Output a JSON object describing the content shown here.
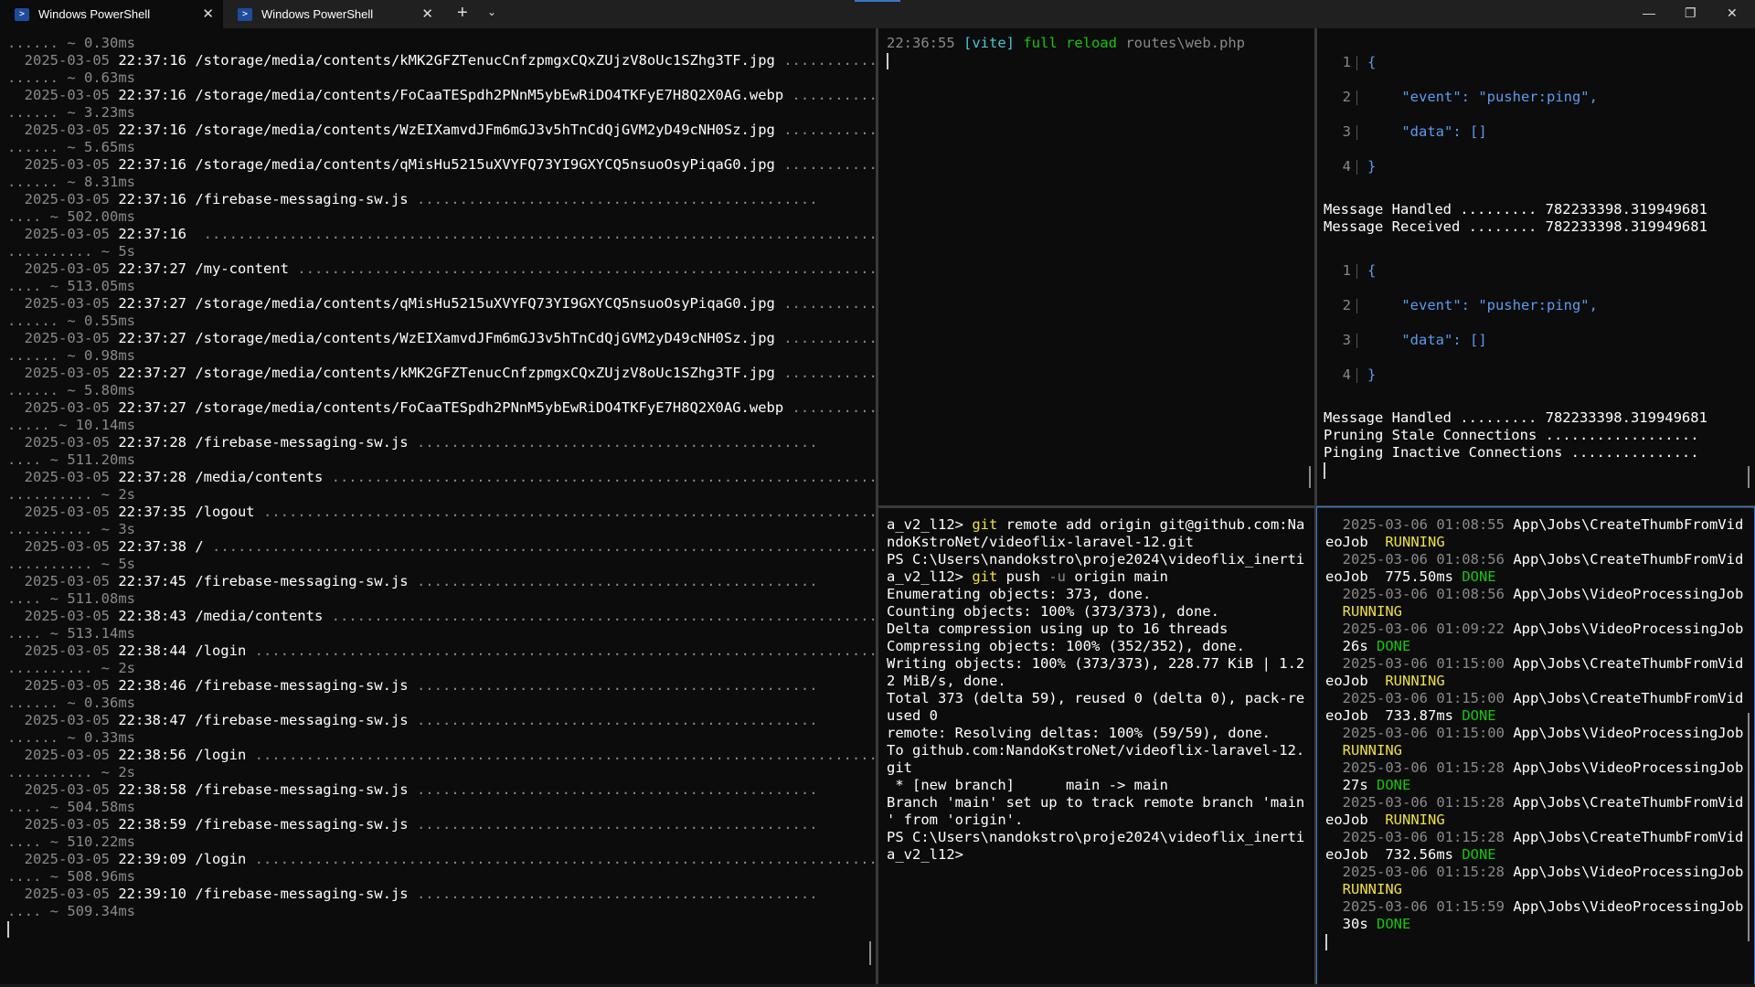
{
  "tabs": [
    {
      "label": "Windows PowerShell",
      "active": true
    },
    {
      "label": "Windows PowerShell",
      "active": false
    }
  ],
  "icons": {
    "tab_icon": "powershell-icon",
    "close": "close-icon",
    "new_tab": "plus-icon",
    "dropdown": "chevron-down-icon",
    "minimize": "minimize-icon",
    "restore": "restore-icon",
    "window_close": "close-icon"
  },
  "left_pane": {
    "lines": [
      {
        "d": "...... ~ 0.30ms"
      },
      {
        "date": "2025-03-05",
        "time": "22:37:16",
        "path": "/storage/media/contents/kMK2GFZTenucCnfzpmgxCQxZUjzV8oUc1SZhg3TF.jpg",
        "dots": " ..........."
      },
      {
        "d": "...... ~ 0.63ms"
      },
      {
        "date": "2025-03-05",
        "time": "22:37:16",
        "path": "/storage/media/contents/FoCaaTESpdh2PNnM5ybEwRiDO4TKFyE7H8Q2X0AG.webp",
        "dots": " .........."
      },
      {
        "d": "...... ~ 3.23ms"
      },
      {
        "date": "2025-03-05",
        "time": "22:37:16",
        "path": "/storage/media/contents/WzEIXamvdJFm6mGJ3v5hTnCdQjGVM2yD49cNH0Sz.jpg",
        "dots": " ..........."
      },
      {
        "d": "...... ~ 5.65ms"
      },
      {
        "date": "2025-03-05",
        "time": "22:37:16",
        "path": "/storage/media/contents/qMisHu5215uXVYFQ73YI9GXYCQ5nsuoOsyPiqaG0.jpg",
        "dots": " ..........."
      },
      {
        "d": "...... ~ 8.31ms"
      },
      {
        "date": "2025-03-05",
        "time": "22:37:16",
        "path": "/firebase-messaging-sw.js",
        "dots": " ..............................................."
      },
      {
        "d": ".... ~ 502.00ms"
      },
      {
        "date": "2025-03-05",
        "time": "22:37:16",
        "path": "",
        "dots": " ................................................................................"
      },
      {
        "d": ".......... ~ 5s"
      },
      {
        "date": "2025-03-05",
        "time": "22:37:27",
        "path": "/my-content",
        "dots": " ........................................................................"
      },
      {
        "d": ".... ~ 513.05ms"
      },
      {
        "date": "2025-03-05",
        "time": "22:37:27",
        "path": "/storage/media/contents/qMisHu5215uXVYFQ73YI9GXYCQ5nsuoOsyPiqaG0.jpg",
        "dots": " ..........."
      },
      {
        "d": "...... ~ 0.55ms"
      },
      {
        "date": "2025-03-05",
        "time": "22:37:27",
        "path": "/storage/media/contents/WzEIXamvdJFm6mGJ3v5hTnCdQjGVM2yD49cNH0Sz.jpg",
        "dots": " ..........."
      },
      {
        "d": "...... ~ 0.98ms"
      },
      {
        "date": "2025-03-05",
        "time": "22:37:27",
        "path": "/storage/media/contents/kMK2GFZTenucCnfzpmgxCQxZUjzV8oUc1SZhg3TF.jpg",
        "dots": " ..........."
      },
      {
        "d": "...... ~ 5.80ms"
      },
      {
        "date": "2025-03-05",
        "time": "22:37:27",
        "path": "/storage/media/contents/FoCaaTESpdh2PNnM5ybEwRiDO4TKFyE7H8Q2X0AG.webp",
        "dots": " .........."
      },
      {
        "d": "..... ~ 10.14ms"
      },
      {
        "date": "2025-03-05",
        "time": "22:37:28",
        "path": "/firebase-messaging-sw.js",
        "dots": " ..............................................."
      },
      {
        "d": ".... ~ 511.20ms"
      },
      {
        "date": "2025-03-05",
        "time": "22:37:28",
        "path": "/media/contents",
        "dots": " ..................................................................."
      },
      {
        "d": ".......... ~ 2s"
      },
      {
        "date": "2025-03-05",
        "time": "22:37:35",
        "path": "/logout",
        "dots": " ..........................................................................."
      },
      {
        "d": ".......... ~ 3s"
      },
      {
        "date": "2025-03-05",
        "time": "22:37:38",
        "path": "/",
        "dots": " ................................................................................."
      },
      {
        "d": ".......... ~ 5s"
      },
      {
        "date": "2025-03-05",
        "time": "22:37:45",
        "path": "/firebase-messaging-sw.js",
        "dots": " ..............................................."
      },
      {
        "d": ".... ~ 511.08ms"
      },
      {
        "date": "2025-03-05",
        "time": "22:38:43",
        "path": "/media/contents",
        "dots": " ..................................................................."
      },
      {
        "d": ".... ~ 513.14ms"
      },
      {
        "date": "2025-03-05",
        "time": "22:38:44",
        "path": "/login",
        "dots": " ..........................................................................."
      },
      {
        "d": ".......... ~ 2s"
      },
      {
        "date": "2025-03-05",
        "time": "22:38:46",
        "path": "/firebase-messaging-sw.js",
        "dots": " ..............................................."
      },
      {
        "d": "...... ~ 0.36ms"
      },
      {
        "date": "2025-03-05",
        "time": "22:38:47",
        "path": "/firebase-messaging-sw.js",
        "dots": " ..............................................."
      },
      {
        "d": "...... ~ 0.33ms"
      },
      {
        "date": "2025-03-05",
        "time": "22:38:56",
        "path": "/login",
        "dots": " ..........................................................................."
      },
      {
        "d": ".......... ~ 2s"
      },
      {
        "date": "2025-03-05",
        "time": "22:38:58",
        "path": "/firebase-messaging-sw.js",
        "dots": " ..............................................."
      },
      {
        "d": ".... ~ 504.58ms"
      },
      {
        "date": "2025-03-05",
        "time": "22:38:59",
        "path": "/firebase-messaging-sw.js",
        "dots": " ..............................................."
      },
      {
        "d": ".... ~ 510.22ms"
      },
      {
        "date": "2025-03-05",
        "time": "22:39:09",
        "path": "/login",
        "dots": " ..........................................................................."
      },
      {
        "d": ".... ~ 508.96ms"
      },
      {
        "date": "2025-03-05",
        "time": "22:39:10",
        "path": "/firebase-messaging-sw.js",
        "dots": " ..............................................."
      },
      {
        "d": ".... ~ 509.34ms"
      }
    ]
  },
  "vite_pane": {
    "time": "22:36:55",
    "tag": "[vite]",
    "action": "full reload",
    "file": "routes\\web.php"
  },
  "json_pane": {
    "blocks": [
      {
        "lines": [
          {
            "n": "1",
            "code": "{"
          },
          {
            "n": "2",
            "code": "    \"event\": \"pusher:ping\","
          },
          {
            "n": "3",
            "code": "    \"data\": []"
          },
          {
            "n": "4",
            "code": "}"
          }
        ]
      },
      {
        "lines": [
          {
            "n": "1",
            "code": "{"
          },
          {
            "n": "2",
            "code": "    \"event\": \"pusher:ping\","
          },
          {
            "n": "3",
            "code": "    \"data\": []"
          },
          {
            "n": "4",
            "code": "}"
          }
        ]
      }
    ],
    "msgs1": [
      "Message Handled ......... 782233398.319949681",
      "Message Received ........ 782233398.319949681"
    ],
    "msgs2": [
      "Message Handled ......... 782233398.319949681",
      "Pruning Stale Connections ..................",
      "Pinging Inactive Connections ..............."
    ]
  },
  "git_pane": {
    "lines": [
      {
        "t": "a_v2_l12> ",
        "cmd": "git",
        "rest": " remote add origin git@github.com:Na"
      },
      {
        "t": "ndoKstroNet/videoflix-laravel-12.git"
      },
      {
        "t": "PS C:\\Users\\nandokstro\\proje2024\\videoflix_inerti"
      },
      {
        "t": "a_v2_l12> ",
        "cmd": "git",
        "rest": " push ",
        "flag": "-u",
        "rest2": " origin main"
      },
      {
        "t": "Enumerating objects: 373, done."
      },
      {
        "t": "Counting objects: 100% (373/373), done."
      },
      {
        "t": "Delta compression using up to 16 threads"
      },
      {
        "t": "Compressing objects: 100% (352/352), done."
      },
      {
        "t": "Writing objects: 100% (373/373), 228.77 KiB | 1.2"
      },
      {
        "t": "2 MiB/s, done."
      },
      {
        "t": "Total 373 (delta 59), reused 0 (delta 0), pack-re"
      },
      {
        "t": "used 0"
      },
      {
        "t": "remote: Resolving deltas: 100% (59/59), done."
      },
      {
        "t": "To github.com:NandoKstroNet/videoflix-laravel-12."
      },
      {
        "t": "git"
      },
      {
        "t": " * [new branch]      main -> main"
      },
      {
        "t": "Branch 'main' set up to track remote branch 'main"
      },
      {
        "t": "' from 'origin'."
      },
      {
        "t": "PS C:\\Users\\nandokstro\\proje2024\\videoflix_inerti"
      },
      {
        "t": "a_v2_l12>"
      }
    ]
  },
  "jobs_pane": {
    "lines": [
      {
        "a": "  2025-03-06 01:08:55 ",
        "b": "App\\Jobs\\CreateThumbFromVid"
      },
      {
        "a": "eoJob  ",
        "status": "RUNNING",
        "kind": "yellow"
      },
      {
        "a": "  2025-03-06 01:08:56 ",
        "b": "App\\Jobs\\CreateThumbFromVid"
      },
      {
        "a": "eoJob  775.50ms ",
        "status": "DONE",
        "kind": "green"
      },
      {
        "a": "  2025-03-06 01:08:56 ",
        "b": "App\\Jobs\\VideoProcessingJob"
      },
      {
        "a": "  ",
        "status": "RUNNING",
        "kind": "yellow"
      },
      {
        "a": "  2025-03-06 01:09:22 ",
        "b": "App\\Jobs\\VideoProcessingJob"
      },
      {
        "a": "  26s ",
        "status": "DONE",
        "kind": "green"
      },
      {
        "a": "  2025-03-06 01:15:00 ",
        "b": "App\\Jobs\\CreateThumbFromVid"
      },
      {
        "a": "eoJob  ",
        "status": "RUNNING",
        "kind": "yellow"
      },
      {
        "a": "  2025-03-06 01:15:00 ",
        "b": "App\\Jobs\\CreateThumbFromVid"
      },
      {
        "a": "eoJob  733.87ms ",
        "status": "DONE",
        "kind": "green"
      },
      {
        "a": "  2025-03-06 01:15:00 ",
        "b": "App\\Jobs\\VideoProcessingJob"
      },
      {
        "a": "  ",
        "status": "RUNNING",
        "kind": "yellow"
      },
      {
        "a": "  2025-03-06 01:15:28 ",
        "b": "App\\Jobs\\VideoProcessingJob"
      },
      {
        "a": "  27s ",
        "status": "DONE",
        "kind": "green"
      },
      {
        "a": "  2025-03-06 01:15:28 ",
        "b": "App\\Jobs\\CreateThumbFromVid"
      },
      {
        "a": "eoJob  ",
        "status": "RUNNING",
        "kind": "yellow"
      },
      {
        "a": "  2025-03-06 01:15:28 ",
        "b": "App\\Jobs\\CreateThumbFromVid"
      },
      {
        "a": "eoJob  732.56ms ",
        "status": "DONE",
        "kind": "green"
      },
      {
        "a": "  2025-03-06 01:15:28 ",
        "b": "App\\Jobs\\VideoProcessingJob"
      },
      {
        "a": "  ",
        "status": "RUNNING",
        "kind": "yellow"
      },
      {
        "a": "  2025-03-06 01:15:59 ",
        "b": "App\\Jobs\\VideoProcessingJob"
      },
      {
        "a": "  30s ",
        "status": "DONE",
        "kind": "green"
      }
    ]
  }
}
